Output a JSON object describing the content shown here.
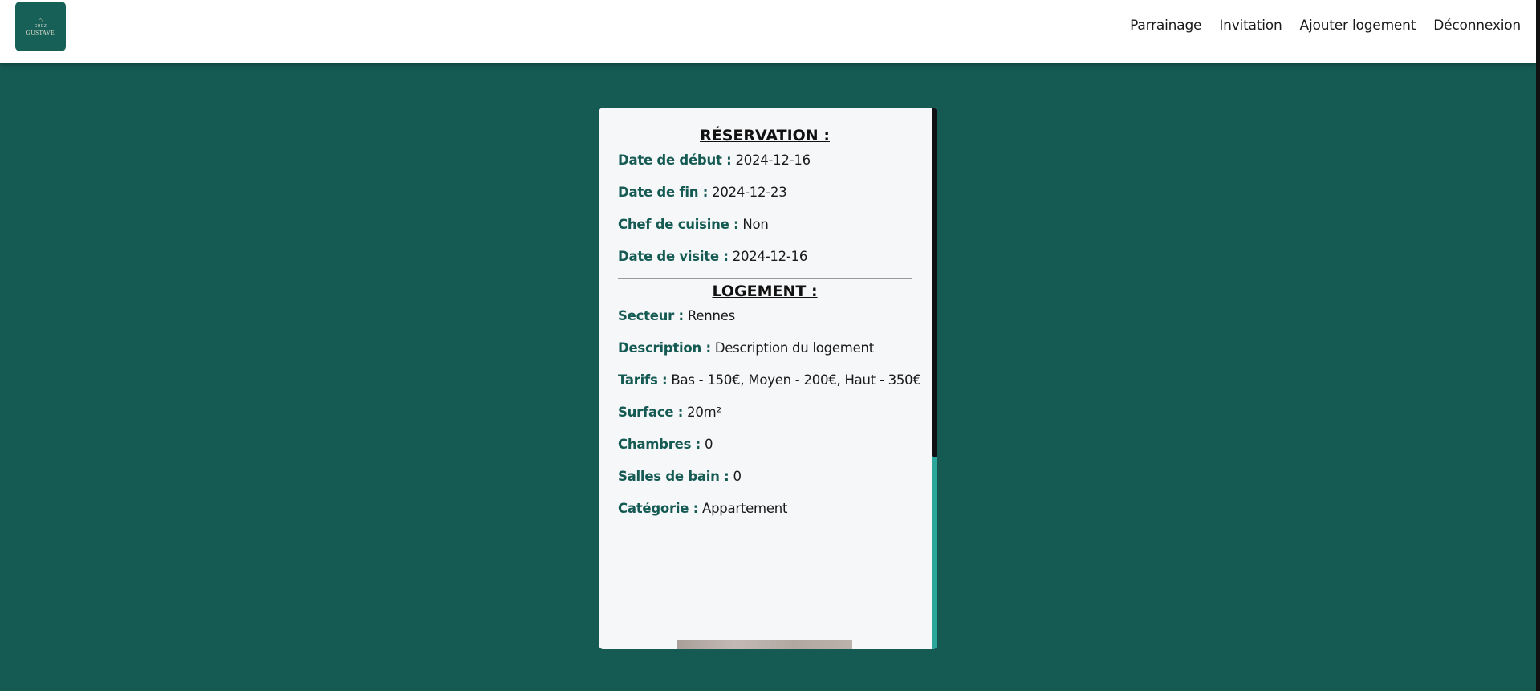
{
  "header": {
    "logo": {
      "mark": "⌂",
      "small": "CHEZ",
      "name": "GUSTAVE"
    },
    "nav": [
      {
        "label": "Parrainage"
      },
      {
        "label": "Invitation"
      },
      {
        "label": "Ajouter logement"
      },
      {
        "label": "Déconnexion"
      }
    ]
  },
  "reservation": {
    "title": "RÉSERVATION :",
    "fields": [
      {
        "label": "Date de début :",
        "value": "2024-12-16"
      },
      {
        "label": "Date de fin :",
        "value": "2024-12-23"
      },
      {
        "label": "Chef de cuisine :",
        "value": "Non"
      },
      {
        "label": "Date de visite :",
        "value": "2024-12-16"
      }
    ]
  },
  "logement": {
    "title": "LOGEMENT :",
    "fields": [
      {
        "label": "Secteur :",
        "value": "Rennes"
      },
      {
        "label": "Description :",
        "value": "Description du logement"
      },
      {
        "label": "Tarifs :",
        "value": "Bas - 150€, Moyen - 200€, Haut - 350€"
      },
      {
        "label": "Surface :",
        "value": "20m²"
      },
      {
        "label": "Chambres :",
        "value": "0"
      },
      {
        "label": "Salles de bain :",
        "value": "0"
      },
      {
        "label": "Catégorie :",
        "value": "Appartement"
      }
    ]
  },
  "colors": {
    "background": "#155a53",
    "label": "#155a53",
    "scroll_accent": "#2aa79a"
  }
}
